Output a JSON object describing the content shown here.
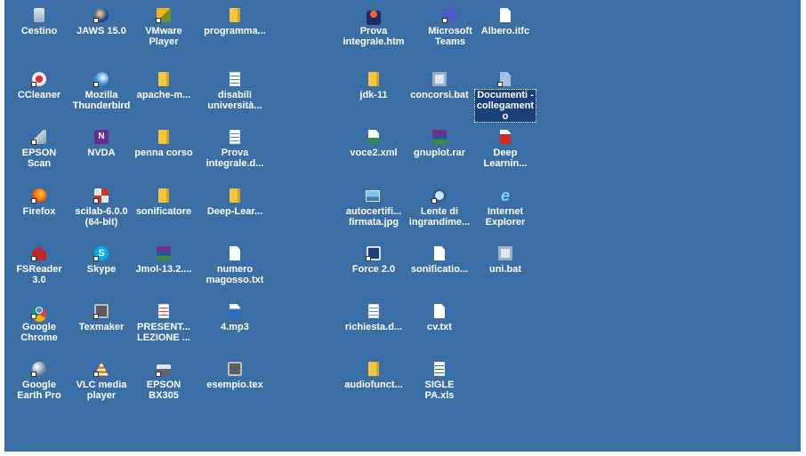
{
  "desktop": {
    "icons": [
      {
        "label": "Cestino",
        "icon": "recycle-bin-icon"
      },
      {
        "label": "JAWS 15.0",
        "icon": "jaws-icon"
      },
      {
        "label": "VMware\nPlayer",
        "icon": "vmware-icon"
      },
      {
        "label": "programma...",
        "icon": "folder-icon"
      },
      {
        "label": "Prova\nintegrale.htm",
        "icon": "html-file-icon"
      },
      {
        "label": "Microsoft\nTeams",
        "icon": "teams-icon"
      },
      {
        "label": "Albero.itfc",
        "icon": "file-icon"
      },
      {
        "label": "CCleaner",
        "icon": "ccleaner-icon"
      },
      {
        "label": "Mozilla\nThunderbird",
        "icon": "thunderbird-icon"
      },
      {
        "label": "apache-m...",
        "icon": "folder-icon"
      },
      {
        "label": "disabili\nuniversità...",
        "icon": "spreadsheet-file-icon"
      },
      {
        "label": "jdk-11",
        "icon": "folder-icon"
      },
      {
        "label": "concorsi.bat",
        "icon": "batch-file-icon"
      },
      {
        "label": "Documenti -\ncollegament\no",
        "icon": "documents-shortcut-icon"
      },
      {
        "label": "EPSON\nScan",
        "icon": "epson-scan-icon"
      },
      {
        "label": "NVDA",
        "icon": "nvda-icon"
      },
      {
        "label": "penna corso",
        "icon": "folder-icon"
      },
      {
        "label": "Prova\nintegrale.d...",
        "icon": "document-file-icon"
      },
      {
        "label": "voce2.xml",
        "icon": "xml-file-icon"
      },
      {
        "label": "gnuplot.rar",
        "icon": "archive-file-icon"
      },
      {
        "label": "Deep\nLearnin...",
        "icon": "pdf-file-icon"
      },
      {
        "label": "Firefox",
        "icon": "firefox-icon"
      },
      {
        "label": "scilab-6.0.0\n(64-bit)",
        "icon": "scilab-icon"
      },
      {
        "label": "sonificatore",
        "icon": "folder-icon"
      },
      {
        "label": "Deep-Lear...",
        "icon": "folder-icon"
      },
      {
        "label": "autocertifi...\nfirmata.jpg",
        "icon": "image-file-icon"
      },
      {
        "label": "Lente di\ningrandime...",
        "icon": "magnifier-icon"
      },
      {
        "label": "Internet\nExplorer",
        "icon": "internet-explorer-icon"
      },
      {
        "label": "FSReader\n3.0",
        "icon": "fsreader-icon"
      },
      {
        "label": "Skype",
        "icon": "skype-icon"
      },
      {
        "label": "Jmol-13.2....",
        "icon": "archive-file-icon"
      },
      {
        "label": "numero\nmagosso.txt",
        "icon": "text-file-icon"
      },
      {
        "label": "Force 2.0",
        "icon": "force-icon"
      },
      {
        "label": "sonificatio...",
        "icon": "file-icon"
      },
      {
        "label": "uni.bat",
        "icon": "batch-file-icon"
      },
      {
        "label": "Google\nChrome",
        "icon": "chrome-icon"
      },
      {
        "label": "Texmaker",
        "icon": "texmaker-icon"
      },
      {
        "label": "PRESENT...\nLEZIONE ...",
        "icon": "presentation-file-icon"
      },
      {
        "label": "4.mp3",
        "icon": "audio-file-icon"
      },
      {
        "label": "richiesta.d...",
        "icon": "document-file-icon"
      },
      {
        "label": "cv.txt",
        "icon": "text-file-icon"
      },
      {
        "label": "Google\nEarth Pro",
        "icon": "google-earth-icon"
      },
      {
        "label": "VLC media\nplayer",
        "icon": "vlc-icon"
      },
      {
        "label": "EPSON\nBX305",
        "icon": "printer-icon"
      },
      {
        "label": "esempio.tex",
        "icon": "tex-file-icon"
      },
      {
        "label": "audiofunct...",
        "icon": "folder-icon"
      },
      {
        "label": "SIGLE\nPA.xls",
        "icon": "excel-file-icon"
      }
    ]
  },
  "colors": {
    "desktop_background": "#3a6ea5",
    "label_text": "#ffffff",
    "selection": "#1b3f7a"
  }
}
